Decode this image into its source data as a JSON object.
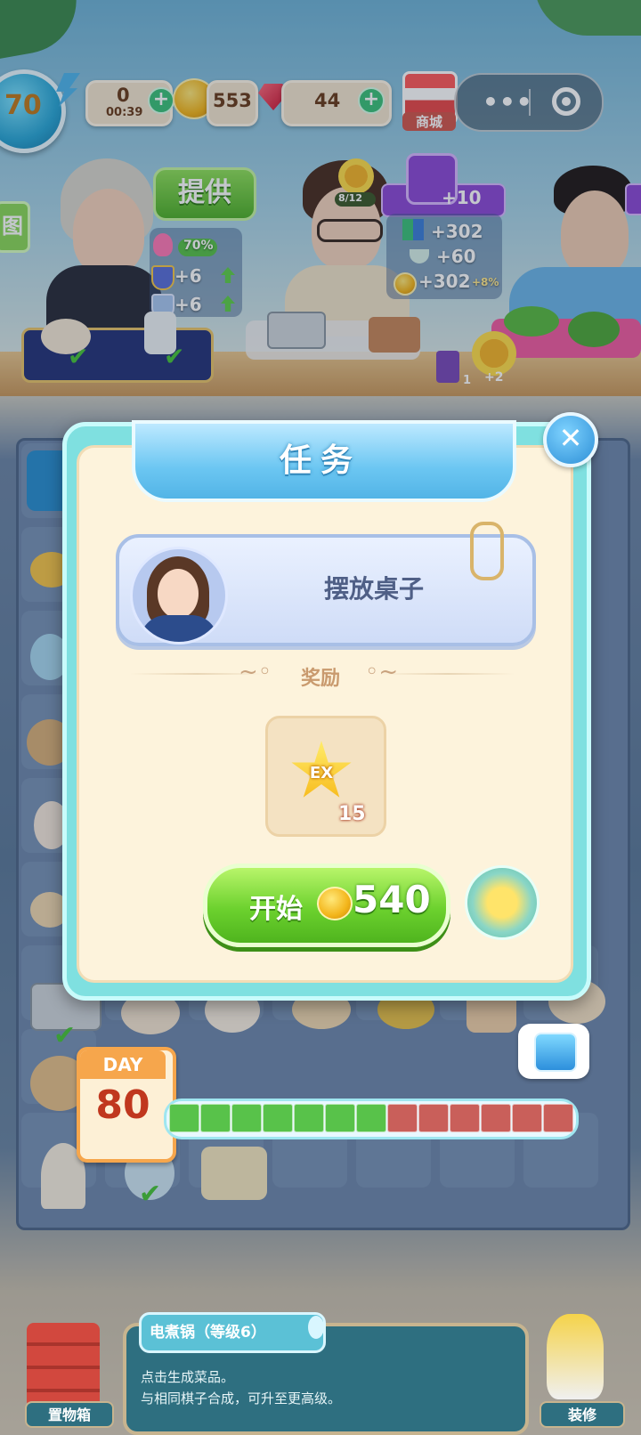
{
  "hud": {
    "level": "70",
    "timer_value": "0",
    "timer_time": "00:39",
    "coins": "553",
    "gems": "44",
    "shop_label": "商城"
  },
  "customers": {
    "provide_button": "提供",
    "left_panel_partial": "图",
    "customer1": {
      "percent": "70%",
      "bonus1": "+6",
      "bonus2": "+6"
    },
    "customer2": {
      "patience": "8/12",
      "tag_value": "+10",
      "reward1": "+302",
      "reward2": "+60",
      "reward3": "+302",
      "reward3_bonus": "+8%"
    },
    "counter_badge": "+2",
    "counter_small": "1"
  },
  "modal": {
    "title": "任务",
    "task_name": "摆放桌子",
    "reward_label": "奖励",
    "reward_icon": "ex-star-icon",
    "reward_icon_text": "EX",
    "reward_quantity": "15",
    "start_label": "开始",
    "start_cost": "540",
    "close_symbol": "✕"
  },
  "day": {
    "label": "DAY",
    "number": "80",
    "progress_filled": 7,
    "progress_total": 13
  },
  "bottom": {
    "storage_label": "置物箱",
    "decorate_label": "装修",
    "info_title": "电煮锅（等级6）",
    "info_line1": "点击生成菜品。",
    "info_line2": "与相同棋子合成，可升至更高级。"
  },
  "colors": {
    "accent_teal": "#7fe0e0",
    "button_green": "#6cd12e",
    "progress_done": "#58c24a",
    "progress_todo": "#c95f5a"
  }
}
